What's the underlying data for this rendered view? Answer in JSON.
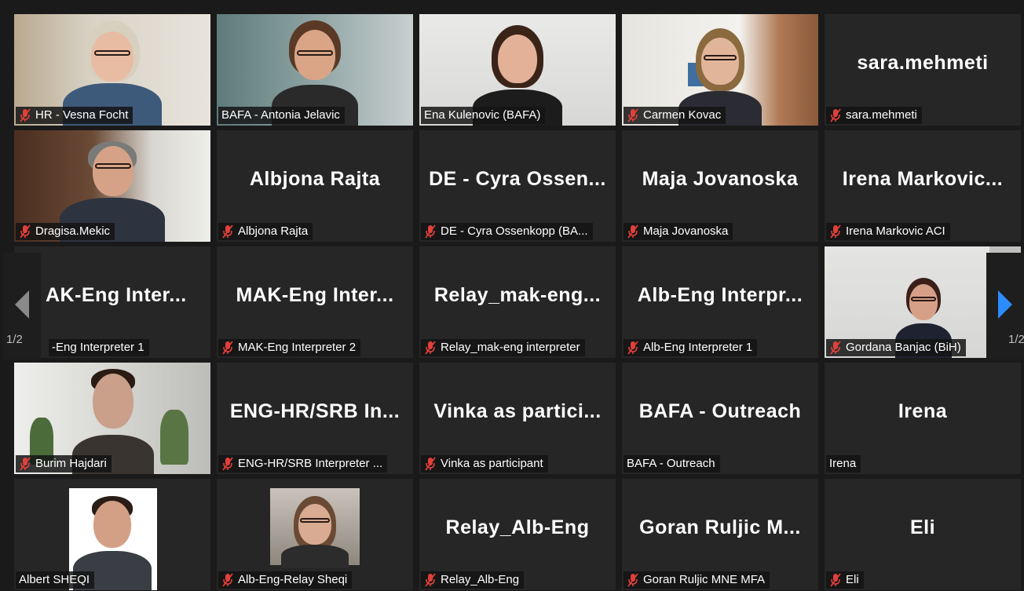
{
  "participants": [
    {
      "bigname": "",
      "label": "HR - Vesna Focht",
      "muted": true
    },
    {
      "bigname": "",
      "label": "BAFA - Antonia Jelavic",
      "muted": false
    },
    {
      "bigname": "",
      "label": "Ena Kulenovic (BAFA)",
      "muted": false
    },
    {
      "bigname": "",
      "label": "Carmen Kovac",
      "muted": true
    },
    {
      "bigname": "sara.mehmeti",
      "label": "sara.mehmeti",
      "muted": true
    },
    {
      "bigname": "",
      "label": "Dragisa.Mekic",
      "muted": true
    },
    {
      "bigname": "Albjona Rajta",
      "label": "Albjona Rajta",
      "muted": true
    },
    {
      "bigname": "DE - Cyra Ossen...",
      "label": "DE - Cyra Ossenkopp (BA...",
      "muted": true
    },
    {
      "bigname": "Maja Jovanoska",
      "label": "Maja Jovanoska",
      "muted": true
    },
    {
      "bigname": "Irena Markovic...",
      "label": "Irena Markovic ACI",
      "muted": true
    },
    {
      "bigname": "AK-Eng Inter...",
      "label": "-Eng Interpreter 1",
      "muted": false
    },
    {
      "bigname": "MAK-Eng Inter...",
      "label": "MAK-Eng Interpreter 2",
      "muted": true
    },
    {
      "bigname": "Relay_mak-eng...",
      "label": "Relay_mak-eng interpreter",
      "muted": true
    },
    {
      "bigname": "Alb-Eng Interpr...",
      "label": "Alb-Eng Interpreter 1",
      "muted": true
    },
    {
      "bigname": "",
      "label": "Gordana Banjac (BiH)",
      "muted": true
    },
    {
      "bigname": "",
      "label": "Burim Hajdari",
      "muted": true
    },
    {
      "bigname": "ENG-HR/SRB In...",
      "label": "ENG-HR/SRB Interpreter ...",
      "muted": true
    },
    {
      "bigname": "Vinka as partici...",
      "label": "Vinka as participant",
      "muted": true
    },
    {
      "bigname": "BAFA - Outreach",
      "label": "BAFA - Outreach",
      "muted": false
    },
    {
      "bigname": "Irena",
      "label": "Irena",
      "muted": false
    },
    {
      "bigname": "",
      "label": "Albert SHEQI",
      "muted": false
    },
    {
      "bigname": "",
      "label": "Alb-Eng-Relay Sheqi",
      "muted": true
    },
    {
      "bigname": "Relay_Alb-Eng",
      "label": "Relay_Alb-Eng",
      "muted": true
    },
    {
      "bigname": "Goran Ruljic M...",
      "label": "Goran Ruljic MNE MFA",
      "muted": true
    },
    {
      "bigname": "Eli",
      "label": "Eli",
      "muted": true
    }
  ],
  "pagination": {
    "left_page": "1/2",
    "right_page": "1/2"
  },
  "colors": {
    "active_speaker": "#dfee8a",
    "muted_icon": "#e0403a",
    "next_arrow": "#2d8cff"
  }
}
